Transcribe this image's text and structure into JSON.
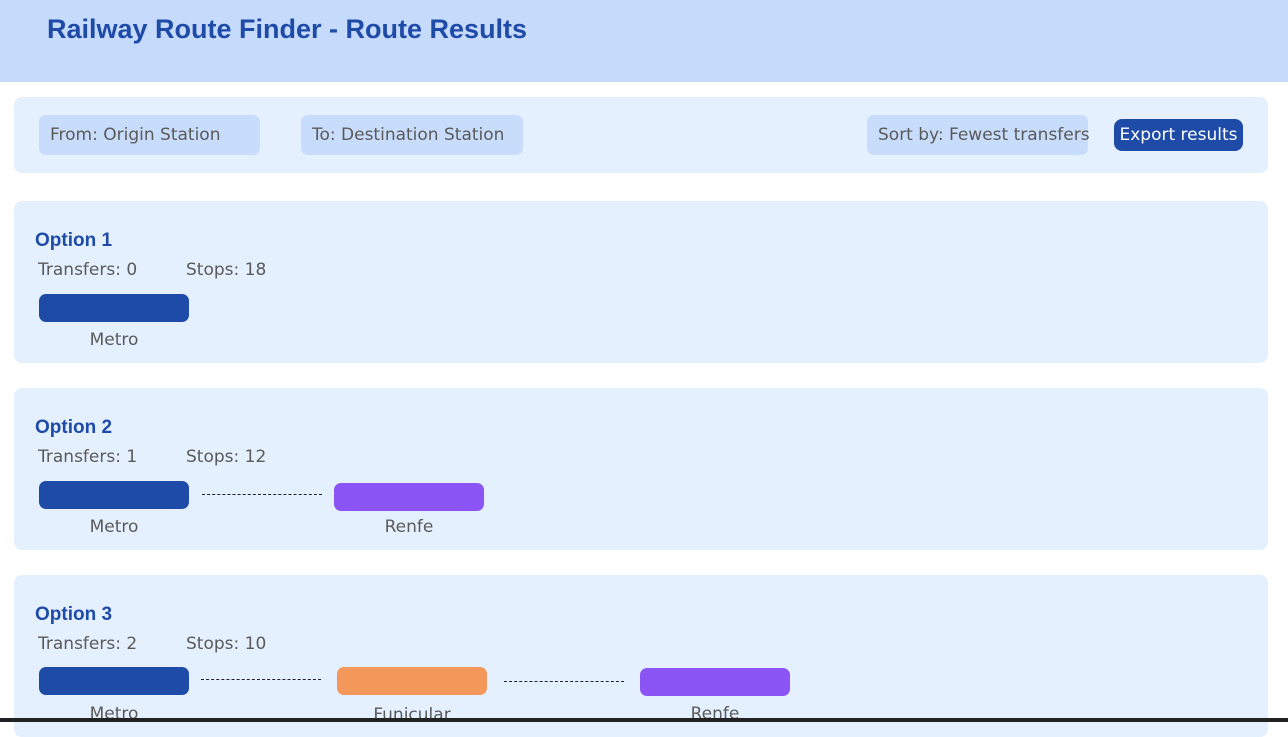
{
  "header": {
    "title": "Railway Route Finder - Route Results"
  },
  "toolbar": {
    "from_value": "From: Origin Station",
    "to_value": "To: Destination Station",
    "sort_value": "Sort by: Fewest transfers",
    "export_label": "Export results"
  },
  "colors": {
    "Metro": "#1e4ba8",
    "Renfe": "#8b55f5",
    "Funicular": "#f3975a"
  },
  "options": [
    {
      "title": "Option 1",
      "transfers": "Transfers: 0",
      "stops": "Stops: 18",
      "legs": [
        "Metro"
      ]
    },
    {
      "title": "Option 2",
      "transfers": "Transfers: 1",
      "stops": "Stops: 12",
      "legs": [
        "Metro",
        "Renfe"
      ]
    },
    {
      "title": "Option 3",
      "transfers": "Transfers: 2",
      "stops": "Stops: 10",
      "legs": [
        "Metro",
        "Funicular",
        "Renfe"
      ]
    }
  ]
}
